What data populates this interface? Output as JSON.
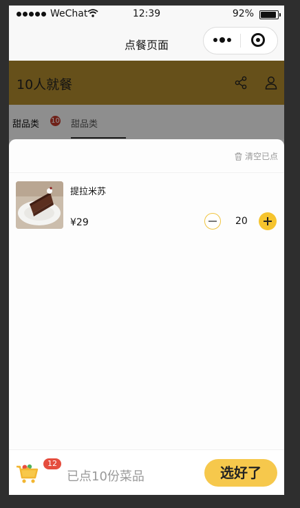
{
  "status_bar": {
    "carrier": "WeChat",
    "time": "12:39",
    "battery": "92%"
  },
  "navbar": {
    "title": "点餐页面"
  },
  "header": {
    "title": "10人就餐"
  },
  "tabs": {
    "items": [
      {
        "label": "甜品类",
        "badge": "10"
      },
      {
        "label": "甜品类"
      }
    ]
  },
  "cart": {
    "clear_label": "清空已点",
    "items": [
      {
        "name": "提拉米苏",
        "price": "¥29",
        "quantity": "20"
      }
    ]
  },
  "footer": {
    "cart_count": "12",
    "summary": "已点10份菜品",
    "confirm_label": "选好了"
  },
  "colors": {
    "accent": "#f6c84c",
    "badge": "#e54d3e",
    "header": "#b08a2e"
  }
}
